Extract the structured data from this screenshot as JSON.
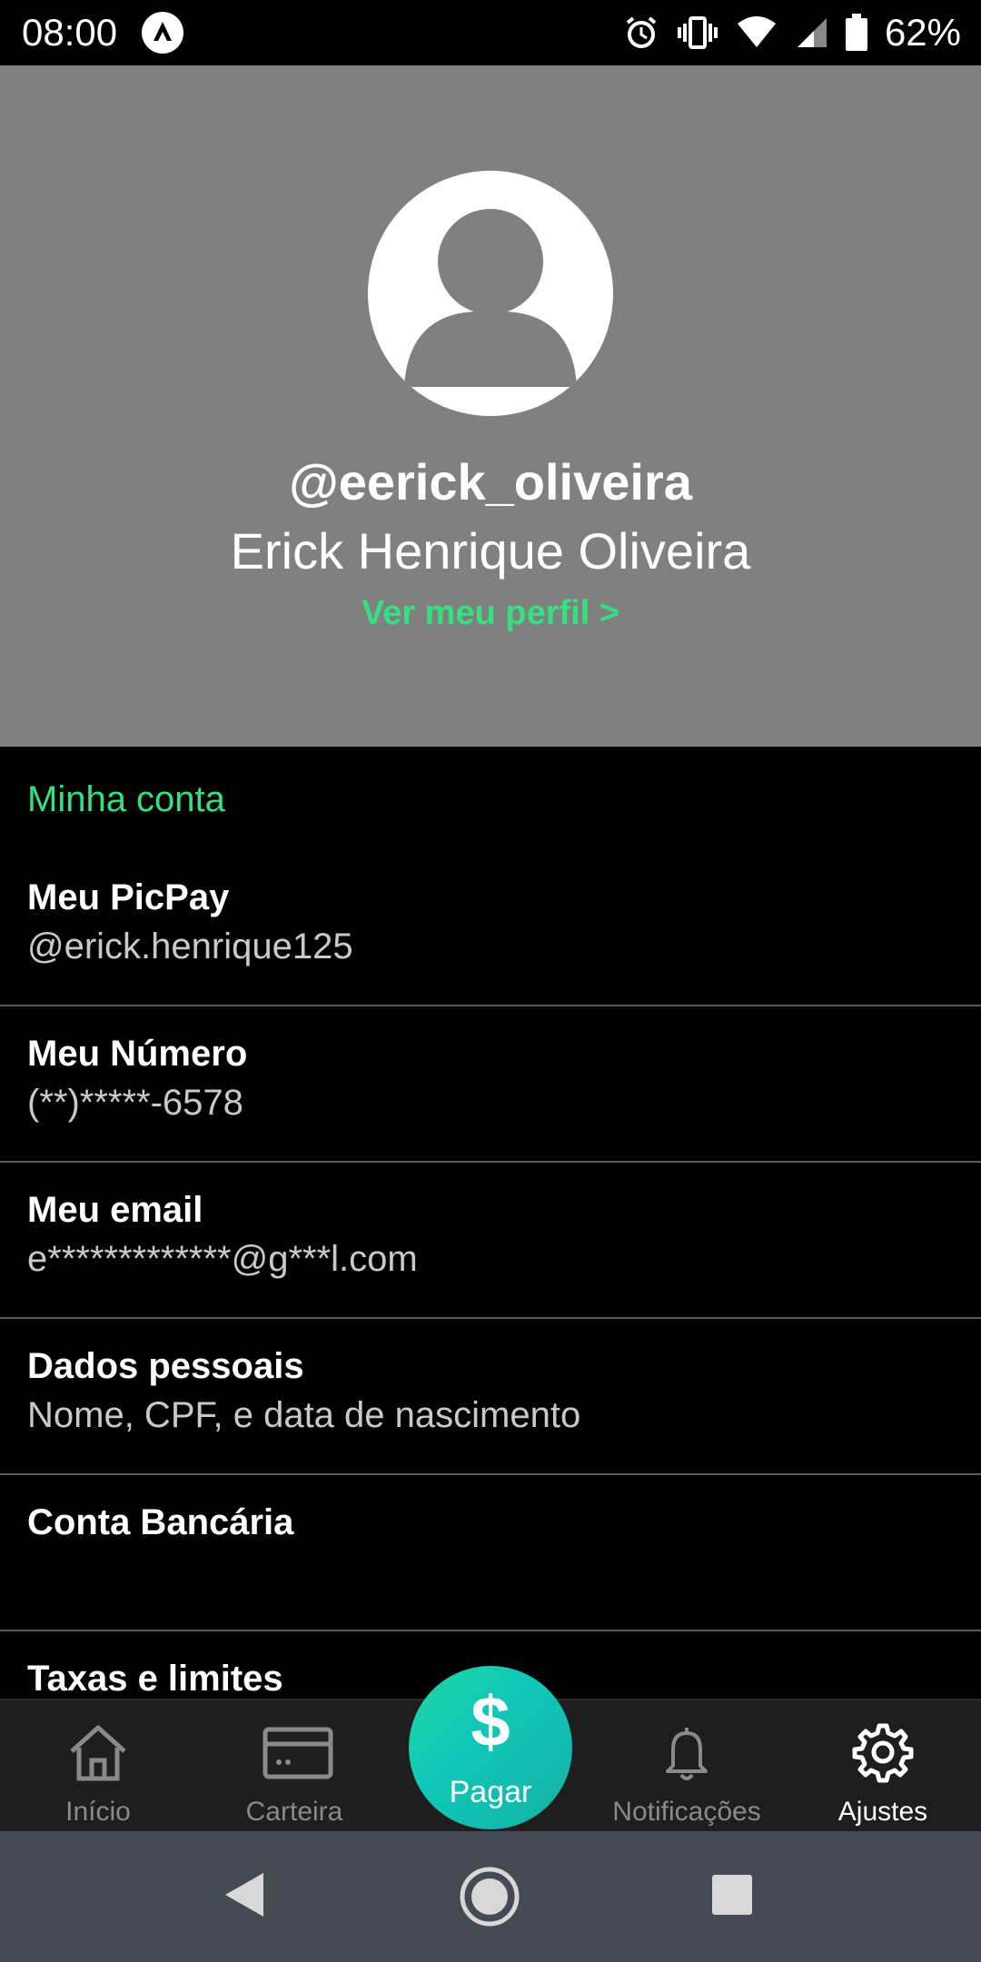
{
  "status_bar": {
    "time": "08:00",
    "battery_percent": "62%",
    "icons": [
      "alarm-icon",
      "vibrate-icon",
      "wifi-icon",
      "signal-icon",
      "battery-icon"
    ]
  },
  "profile": {
    "username": "@eerick_oliveira",
    "full_name": "Erick Henrique Oliveira",
    "view_profile": "Ver meu perfil >"
  },
  "account": {
    "section_title": "Minha conta",
    "items": [
      {
        "title": "Meu PicPay",
        "subtitle": "@erick.henrique125"
      },
      {
        "title": "Meu Número",
        "subtitle": "(**)*****-6578"
      },
      {
        "title": "Meu email",
        "subtitle": "e*************@g***l.com"
      },
      {
        "title": "Dados pessoais",
        "subtitle": "Nome, CPF, e data de nascimento"
      },
      {
        "title": "Conta Bancária",
        "subtitle": ""
      },
      {
        "title": "Taxas e limites",
        "subtitle": ""
      }
    ]
  },
  "bottom_nav": {
    "home": "Início",
    "wallet": "Carteira",
    "pay_symbol": "$",
    "pay": "Pagar",
    "notifications": "Notificações",
    "settings": "Ajustes",
    "active": "settings"
  },
  "colors": {
    "accent": "#35e07e",
    "header_bg": "#808080",
    "nav_bg": "#1e1e1e",
    "android_nav_bg": "#454b52"
  }
}
